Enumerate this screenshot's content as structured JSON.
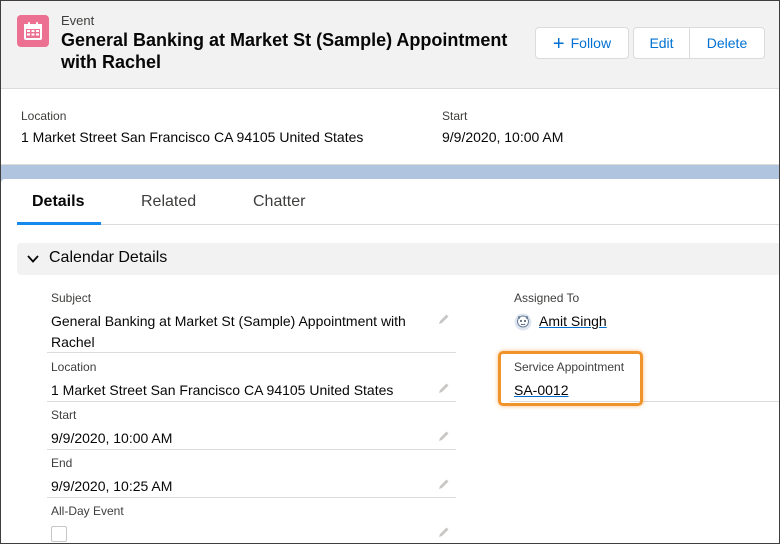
{
  "header": {
    "object_label": "Event",
    "title": "General Banking at Market St (Sample) Appointment with Rachel",
    "follow_label": "Follow",
    "edit_label": "Edit",
    "delete_label": "Delete",
    "icon": "calendar-icon",
    "icon_color": "#eb7092"
  },
  "highlights": {
    "location_label": "Location",
    "location_value": "1 Market Street San Francisco CA 94105 United States",
    "start_label": "Start",
    "start_value": "9/9/2020, 10:00 AM"
  },
  "tabs": [
    {
      "label": "Details",
      "active": true
    },
    {
      "label": "Related",
      "active": false
    },
    {
      "label": "Chatter",
      "active": false
    }
  ],
  "section": {
    "title": "Calendar Details"
  },
  "fields": {
    "subject_label": "Subject",
    "subject_value": "General Banking at Market St (Sample) Appointment with Rachel",
    "location_label": "Location",
    "location_value": "1 Market Street San Francisco CA 94105 United States",
    "start_label": "Start",
    "start_value": "9/9/2020, 10:00 AM",
    "end_label": "End",
    "end_value": "9/9/2020, 10:25 AM",
    "allday_label": "All-Day Event",
    "allday_checked": false,
    "assigned_label": "Assigned To",
    "assigned_value": "Amit Singh",
    "service_label": "Service Appointment",
    "service_value": "SA-0012"
  },
  "colors": {
    "link": "#006dcc",
    "callout": "#f0932b",
    "tab_active": "#1589ee"
  }
}
